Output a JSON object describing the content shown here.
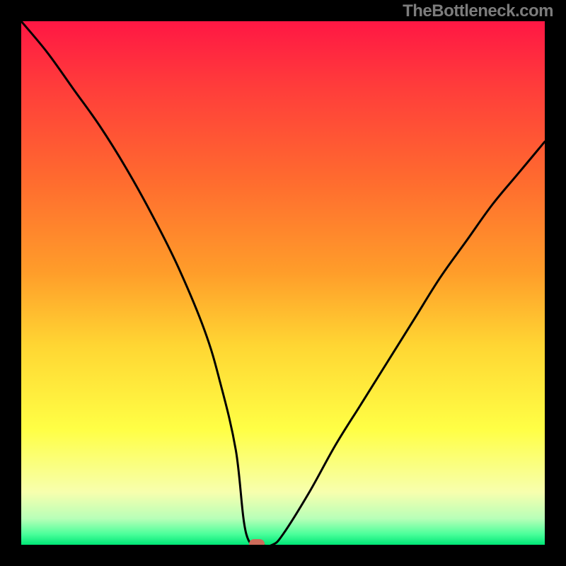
{
  "watermark": "TheBottleneck.com",
  "chart_data": {
    "type": "line",
    "title": "",
    "xlabel": "",
    "ylabel": "",
    "xlim": [
      0,
      100
    ],
    "ylim": [
      0,
      100
    ],
    "series": [
      {
        "name": "curve",
        "x": [
          0,
          5,
          10,
          15,
          20,
          25,
          30,
          35,
          38,
          41,
          43,
          46,
          48,
          50,
          55,
          60,
          65,
          70,
          75,
          80,
          85,
          90,
          95,
          100
        ],
        "values": [
          100,
          94,
          87,
          80,
          72,
          63,
          53,
          41,
          31,
          18,
          2,
          0,
          0,
          2,
          10,
          19,
          27,
          35,
          43,
          51,
          58,
          65,
          71,
          77
        ]
      }
    ],
    "marker": {
      "x": 45,
      "y": 0
    },
    "gradient_stops": [
      {
        "offset": 0.0,
        "color": "#ff1744"
      },
      {
        "offset": 0.12,
        "color": "#ff3b3b"
      },
      {
        "offset": 0.3,
        "color": "#ff6a2f"
      },
      {
        "offset": 0.48,
        "color": "#ff9d2a"
      },
      {
        "offset": 0.62,
        "color": "#ffd633"
      },
      {
        "offset": 0.78,
        "color": "#ffff45"
      },
      {
        "offset": 0.9,
        "color": "#f7ffae"
      },
      {
        "offset": 0.95,
        "color": "#b8ffb8"
      },
      {
        "offset": 0.98,
        "color": "#4aff9a"
      },
      {
        "offset": 1.0,
        "color": "#00e676"
      }
    ],
    "curve_color": "#000000",
    "marker_color": "#cc6b5a"
  }
}
